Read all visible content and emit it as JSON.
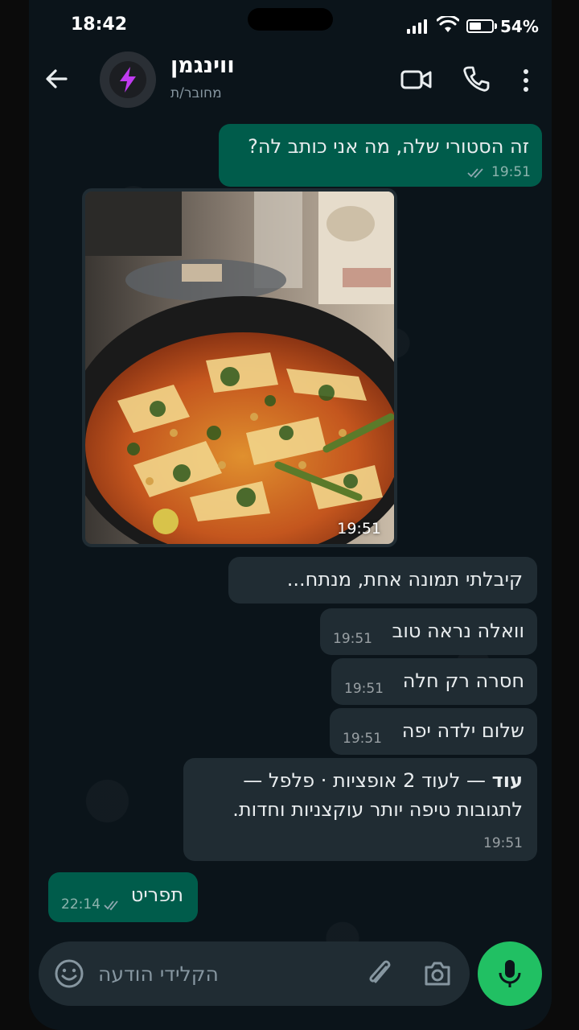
{
  "status_bar": {
    "time": "18:42",
    "battery_percent_label": "54%",
    "battery_level": 0.54
  },
  "header": {
    "contact_name": "ווינגמן",
    "contact_status": "מחובר/ת",
    "avatar_icon": "lightning-bolt-icon",
    "accent_color": "#c03bf0"
  },
  "messages": [
    {
      "direction": "out",
      "text": "זה הסטורי שלה, מה אני כותב לה?",
      "time": "19:51",
      "status": "read"
    },
    {
      "direction": "in",
      "type": "image",
      "alt": "",
      "time": "19:51"
    },
    {
      "direction": "in",
      "text": "קיבלתי תמונה אחת, מנתח..."
    },
    {
      "direction": "in",
      "text": "וואלה נראה טוב",
      "time": "19:51"
    },
    {
      "direction": "in",
      "text": "חסרה רק חלה",
      "time": "19:51"
    },
    {
      "direction": "in",
      "text": "שלום ילדה יפה",
      "time": "19:51"
    },
    {
      "direction": "in",
      "bold": "עוד",
      "line1_rest": " — לעוד 2 אופציות  ·  פלפל —",
      "line2": "לתגובות טיפה יותר עוקצניות וחדות.",
      "time": "19:51"
    },
    {
      "direction": "out",
      "text": "תפריט",
      "time": "22:14",
      "status": "read"
    }
  ],
  "input": {
    "placeholder": "הקלידי הודעה"
  },
  "colors": {
    "outgoing_bubble": "#005c4b",
    "incoming_bubble": "#202c33",
    "background": "#0b141a",
    "mic_button": "#21c063"
  }
}
